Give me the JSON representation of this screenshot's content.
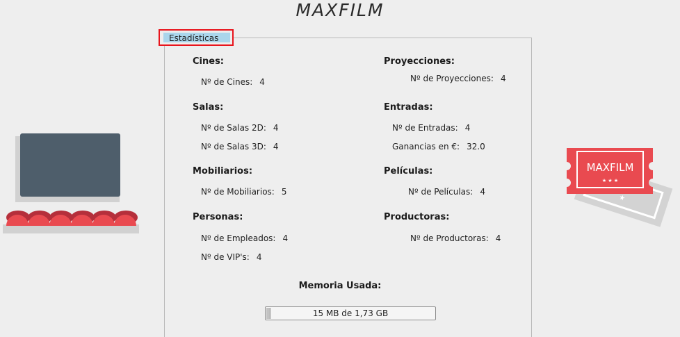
{
  "app": {
    "title": "MAXFILM"
  },
  "tab": {
    "label": "Estadísticas"
  },
  "stats": {
    "cines": {
      "title": "Cines:",
      "rows": [
        {
          "label": "Nº de Cines:",
          "value": "4"
        }
      ]
    },
    "salas": {
      "title": "Salas:",
      "rows": [
        {
          "label": "Nº de Salas 2D:",
          "value": "4"
        },
        {
          "label": "Nº de Salas 3D:",
          "value": "4"
        }
      ]
    },
    "mobiliarios": {
      "title": "Mobiliarios:",
      "rows": [
        {
          "label": "Nº de Mobiliarios:",
          "value": "5"
        }
      ]
    },
    "personas": {
      "title": "Personas:",
      "rows": [
        {
          "label": "Nº de Empleados:",
          "value": "4"
        },
        {
          "label": "Nº de VIP's:",
          "value": "4"
        }
      ]
    },
    "proyecciones": {
      "title": "Proyecciones:",
      "rows": [
        {
          "label": "Nº de Proyecciones:",
          "value": "4"
        }
      ]
    },
    "entradas": {
      "title": "Entradas:",
      "rows": [
        {
          "label": "Nº de Entradas:",
          "value": "4"
        },
        {
          "label": "Ganancias en €:",
          "value": "32.0"
        }
      ]
    },
    "peliculas": {
      "title": "Películas:",
      "rows": [
        {
          "label": "Nº de Películas:",
          "value": "4"
        }
      ]
    },
    "productoras": {
      "title": "Productoras:",
      "rows": [
        {
          "label": "Nº de Productoras:",
          "value": "4"
        }
      ]
    }
  },
  "memory": {
    "title": "Memoria Usada:",
    "text": "15 MB de 1,73 GB",
    "used_fraction": 0.008
  },
  "ticket": {
    "brand": "MAXFILM",
    "stars": "★ ★ ★"
  },
  "colors": {
    "accent_red": "#e94a50",
    "screen": "#4e5e6b",
    "tab_blue": "#aad6ec",
    "focus_red": "#e8141c"
  }
}
